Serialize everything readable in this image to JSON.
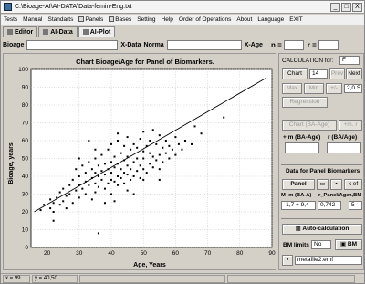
{
  "window": {
    "title": "C:\\Bioage-AI\\AI-DATA\\Data-femin-Eng.txt",
    "min": "_",
    "max": "□",
    "close": "X"
  },
  "menu": [
    "Tests",
    "Manual",
    "Standarts",
    "Panels",
    "Bases",
    "Setting",
    "Help",
    "Order of Operations",
    "About",
    "Language",
    "EXIT"
  ],
  "tabs": [
    "Editor",
    "AI-Data",
    "AI-Plot"
  ],
  "inputs": {
    "bioage_label": "Bioage",
    "xdata_label": "X-Data",
    "norma_label": "Norma",
    "xage_label": "X-Age",
    "n_label": "n =",
    "r_label": "r ="
  },
  "chart_data": {
    "type": "scatter",
    "title": "Chart Bioage/Age for Panel of Biomarkers.",
    "xlabel": "Age, Years",
    "ylabel": "Bioage, years",
    "xlim": [
      15,
      90
    ],
    "ylim": [
      0,
      100
    ],
    "xticks": [
      20,
      30,
      40,
      50,
      60,
      70,
      80,
      90
    ],
    "yticks": [
      0,
      10,
      20,
      30,
      40,
      50,
      60,
      70,
      80,
      90,
      100
    ],
    "grid": true,
    "regression_line": [
      [
        16,
        20
      ],
      [
        88,
        95
      ]
    ],
    "points": [
      [
        18,
        21
      ],
      [
        19,
        24
      ],
      [
        21,
        22
      ],
      [
        21,
        27
      ],
      [
        22,
        20
      ],
      [
        22,
        25
      ],
      [
        23,
        28
      ],
      [
        24,
        24
      ],
      [
        24,
        31
      ],
      [
        25,
        26
      ],
      [
        25,
        33
      ],
      [
        26,
        22
      ],
      [
        26,
        29
      ],
      [
        27,
        35
      ],
      [
        27,
        30
      ],
      [
        28,
        25
      ],
      [
        28,
        38
      ],
      [
        29,
        32
      ],
      [
        29,
        44
      ],
      [
        30,
        28
      ],
      [
        30,
        35
      ],
      [
        30,
        40
      ],
      [
        31,
        33
      ],
      [
        31,
        46
      ],
      [
        32,
        30
      ],
      [
        32,
        37
      ],
      [
        32,
        42
      ],
      [
        33,
        35
      ],
      [
        33,
        48
      ],
      [
        34,
        27
      ],
      [
        34,
        39
      ],
      [
        34,
        44
      ],
      [
        35,
        31
      ],
      [
        35,
        36
      ],
      [
        35,
        42
      ],
      [
        35,
        50
      ],
      [
        36,
        34
      ],
      [
        36,
        40
      ],
      [
        36,
        46
      ],
      [
        37,
        38
      ],
      [
        37,
        43
      ],
      [
        37,
        52
      ],
      [
        38,
        33
      ],
      [
        38,
        41
      ],
      [
        38,
        47
      ],
      [
        39,
        36
      ],
      [
        39,
        44
      ],
      [
        39,
        55
      ],
      [
        40,
        30
      ],
      [
        40,
        38
      ],
      [
        40,
        42
      ],
      [
        40,
        48
      ],
      [
        40,
        58
      ],
      [
        41,
        37
      ],
      [
        41,
        45
      ],
      [
        41,
        51
      ],
      [
        42,
        35
      ],
      [
        42,
        40
      ],
      [
        42,
        47
      ],
      [
        42,
        60
      ],
      [
        43,
        39
      ],
      [
        43,
        44
      ],
      [
        43,
        53
      ],
      [
        44,
        36
      ],
      [
        44,
        42
      ],
      [
        44,
        49
      ],
      [
        44,
        57
      ],
      [
        45,
        32
      ],
      [
        45,
        41
      ],
      [
        45,
        46
      ],
      [
        45,
        51
      ],
      [
        45,
        62
      ],
      [
        46,
        38
      ],
      [
        46,
        44
      ],
      [
        46,
        55
      ],
      [
        47,
        40
      ],
      [
        47,
        48
      ],
      [
        47,
        58
      ],
      [
        48,
        43
      ],
      [
        48,
        50
      ],
      [
        48,
        56
      ],
      [
        49,
        39
      ],
      [
        49,
        46
      ],
      [
        49,
        61
      ],
      [
        50,
        44
      ],
      [
        50,
        50
      ],
      [
        50,
        54
      ],
      [
        50,
        65
      ],
      [
        51,
        42
      ],
      [
        51,
        57
      ],
      [
        52,
        47
      ],
      [
        52,
        53
      ],
      [
        52,
        60
      ],
      [
        53,
        45
      ],
      [
        53,
        51
      ],
      [
        53,
        66
      ],
      [
        54,
        49
      ],
      [
        54,
        58
      ],
      [
        55,
        44
      ],
      [
        55,
        52
      ],
      [
        55,
        63
      ],
      [
        56,
        48
      ],
      [
        56,
        56
      ],
      [
        57,
        53
      ],
      [
        57,
        60
      ],
      [
        58,
        50
      ],
      [
        58,
        57
      ],
      [
        59,
        55
      ],
      [
        60,
        52
      ],
      [
        60,
        62
      ],
      [
        61,
        58
      ],
      [
        62,
        55
      ],
      [
        63,
        60
      ],
      [
        65,
        58
      ],
      [
        66,
        68
      ],
      [
        68,
        64
      ],
      [
        75,
        73
      ],
      [
        35,
        55
      ],
      [
        42,
        64
      ],
      [
        30,
        50
      ],
      [
        38,
        25
      ],
      [
        47,
        30
      ],
      [
        33,
        60
      ],
      [
        41,
        26
      ],
      [
        36,
        8
      ],
      [
        22,
        15
      ],
      [
        50,
        38
      ],
      [
        55,
        38
      ]
    ]
  },
  "right_panel": {
    "calc_label": "CALCULATION for:",
    "calc_value": "F",
    "chart_btn": "Chart",
    "chart_num": "14",
    "prev": "Prev",
    "next": "Next",
    "max": "Max",
    "min": "Min",
    "plus_minus": "+/-",
    "n_sd": "2,0 S",
    "regression": "Regression",
    "chart_ba_age": "Chart (BA-Age)",
    "plus_m": "+m. r",
    "ba_age_m": "+ m (BA-Age)",
    "ba_age_r": "r (BA/Age)",
    "data_panel_title": "Data for Panel Biomarkers",
    "panel_btn": "Panel",
    "kef_btn": "k ef",
    "mpanel_label": "M+m (BA-A)",
    "rpanel_label": "r_Panel/Age",
    "nbm_label": "n,BM",
    "mpanel_val": "-1,7 + 9,4",
    "rpanel_val": "0,742",
    "nbm_val": "5",
    "auto_calc": "Auto-calculation",
    "bm_limits": "BM limits",
    "bm_val": "No",
    "bm_btn": "BM",
    "metafile": "metafile2.emf"
  },
  "status": {
    "x": "x = 99",
    "y": "y = 40,50"
  }
}
